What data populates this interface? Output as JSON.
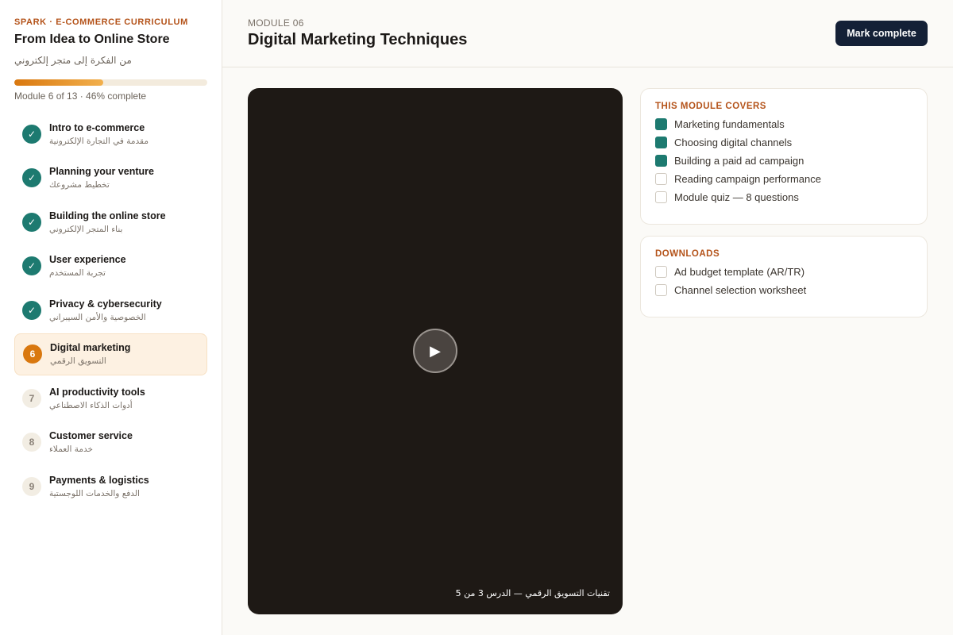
{
  "sidebar": {
    "eyebrow": "SPARK · E-COMMERCE CURRICULUM",
    "title": "From Idea to Online Store",
    "title_ar": "من الفكرة إلى متجر إلكتروني",
    "progress_percent": 46,
    "progress_text": "Module 6 of 13 · 46% complete",
    "modules": [
      {
        "num": "✓",
        "status": "done",
        "label": "Intro to e-commerce",
        "label_ar": "مقدمة في التجارة الإلكترونية"
      },
      {
        "num": "✓",
        "status": "done",
        "label": "Planning your venture",
        "label_ar": "تخطيط مشروعك"
      },
      {
        "num": "✓",
        "status": "done",
        "label": "Building the online store",
        "label_ar": "بناء المتجر الإلكتروني"
      },
      {
        "num": "✓",
        "status": "done",
        "label": "User experience",
        "label_ar": "تجربة المستخدم"
      },
      {
        "num": "✓",
        "status": "done",
        "label": "Privacy & cybersecurity",
        "label_ar": "الخصوصية والأمن السيبراني"
      },
      {
        "num": "6",
        "status": "current",
        "label": "Digital marketing",
        "label_ar": "التسويق الرقمي"
      },
      {
        "num": "7",
        "status": "todo",
        "label": "AI productivity tools",
        "label_ar": "أدوات الذكاء الاصطناعي"
      },
      {
        "num": "8",
        "status": "todo",
        "label": "Customer service",
        "label_ar": "خدمة العملاء"
      },
      {
        "num": "9",
        "status": "todo",
        "label": "Payments & logistics",
        "label_ar": "الدفع والخدمات اللوجستية"
      }
    ]
  },
  "header": {
    "module_label": "MODULE 06",
    "title": "Digital Marketing Techniques",
    "mark_complete_label": "Mark complete"
  },
  "video": {
    "play_icon": "play-icon",
    "caption": "تقنيات التسويق الرقمي — الدرس 3 من 5"
  },
  "covers": {
    "title": "THIS MODULE COVERS",
    "items": [
      {
        "label": "Marketing fundamentals",
        "checked": true
      },
      {
        "label": "Choosing digital channels",
        "checked": true
      },
      {
        "label": "Building a paid ad campaign",
        "checked": true
      },
      {
        "label": "Reading campaign performance",
        "checked": false
      },
      {
        "label": "Module quiz — 8 questions",
        "checked": false
      }
    ]
  },
  "downloads": {
    "title": "DOWNLOADS",
    "items": [
      {
        "label": "Ad budget template (AR/TR)",
        "checked": false
      },
      {
        "label": "Channel selection worksheet",
        "checked": false
      }
    ]
  },
  "colors": {
    "accent": "#d9780f",
    "teal": "#1d7a70",
    "navy": "#142036",
    "eyebrow": "#b4531a"
  }
}
